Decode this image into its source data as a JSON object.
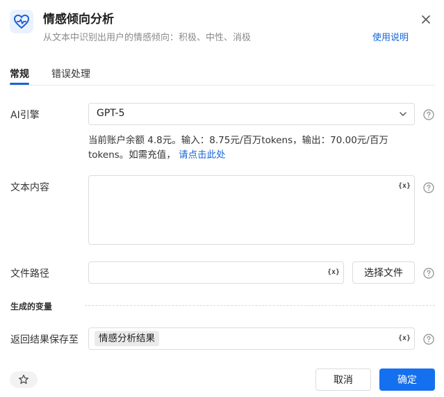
{
  "header": {
    "title": "情感倾向分析",
    "subtitle": "从文本中识别出用户的情感倾向：积极、中性、消极",
    "help_link": "使用说明",
    "icon": "heart-pulse-icon"
  },
  "tabs": [
    {
      "label": "常规",
      "active": true
    },
    {
      "label": "错误处理",
      "active": false
    }
  ],
  "ai_engine": {
    "label": "AI引擎",
    "value": "GPT-5",
    "account_info": "当前账户余额 4.8元。输入：8.75元/百万tokens，输出：70.00元/百万tokens。如需充值，",
    "recharge_link": "请点击此处"
  },
  "text_content": {
    "label": "文本内容",
    "value": "",
    "var_button": "{x}"
  },
  "file_path": {
    "label": "文件路径",
    "value": "",
    "var_button": "{x}",
    "choose_button": "选择文件"
  },
  "generated_vars": {
    "section_title": "生成的变量"
  },
  "result": {
    "label": "返回结果保存至",
    "tag": "情感分析结果",
    "var_button": "{x}"
  },
  "footer": {
    "cancel": "取消",
    "confirm": "确定"
  },
  "colors": {
    "accent": "#1570ef",
    "link": "#1565d8",
    "icon_bg": "#eaf2ff"
  }
}
